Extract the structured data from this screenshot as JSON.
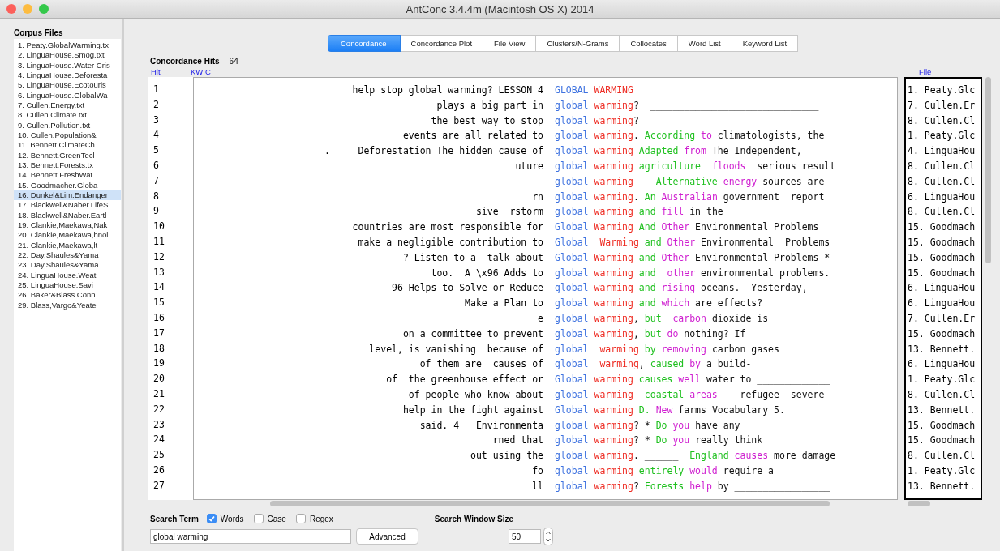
{
  "window": {
    "title": "AntConc 3.4.4m (Macintosh OS X) 2014"
  },
  "corpus_files": {
    "title": "Corpus Files",
    "items": [
      {
        "label": "1. Peaty.GlobalWarming.tx",
        "selected": false
      },
      {
        "label": "2. LinguaHouse.Smog.txt",
        "selected": false
      },
      {
        "label": "3. LinguaHouse.Water Cris",
        "selected": false
      },
      {
        "label": "4. LinguaHouse.Deforesta",
        "selected": false
      },
      {
        "label": "5. LinguaHouse.Ecotouris",
        "selected": false
      },
      {
        "label": "6. LinguaHouse.GlobalWa",
        "selected": false
      },
      {
        "label": "7. Cullen.Energy.txt",
        "selected": false
      },
      {
        "label": "8. Cullen.Climate.txt",
        "selected": false
      },
      {
        "label": "9. Cullen.Pollution.txt",
        "selected": false
      },
      {
        "label": "10. Cullen.Population&",
        "selected": false
      },
      {
        "label": "11. Bennett.ClimateCh",
        "selected": false
      },
      {
        "label": "12. Bennett.GreenTecl",
        "selected": false
      },
      {
        "label": "13. Bennett.Forests.tx",
        "selected": false
      },
      {
        "label": "14. Bennett.FreshWat",
        "selected": false
      },
      {
        "label": "15. Goodmacher.Globa",
        "selected": false
      },
      {
        "label": "16. Dunkel&Lim.Endanger",
        "selected": true
      },
      {
        "label": "17. Blackwell&Naber.LifeS",
        "selected": false
      },
      {
        "label": "18. Blackwell&Naber.Eartl",
        "selected": false
      },
      {
        "label": "19. Clankie,Maekawa,Nak",
        "selected": false
      },
      {
        "label": "20. Clankie,Maekawa,hnol",
        "selected": false
      },
      {
        "label": "21. Clankie,Maekawa,lt",
        "selected": false
      },
      {
        "label": "22. Day,Shaules&Yama",
        "selected": false
      },
      {
        "label": "23. Day,Shaules&Yama",
        "selected": false
      },
      {
        "label": "24. LinguaHouse.Weat",
        "selected": false
      },
      {
        "label": "25. LinguaHouse.Savi",
        "selected": false
      },
      {
        "label": "26. Baker&Blass.Conn",
        "selected": false
      },
      {
        "label": "29. Blass,Vargo&Yeate",
        "selected": false
      }
    ]
  },
  "tabs": [
    {
      "label": "Concordance",
      "selected": true
    },
    {
      "label": "Concordance Plot",
      "selected": false
    },
    {
      "label": "File View",
      "selected": false
    },
    {
      "label": "Clusters/N-Grams",
      "selected": false
    },
    {
      "label": "Collocates",
      "selected": false
    },
    {
      "label": "Word List",
      "selected": false
    },
    {
      "label": "Keyword List",
      "selected": false
    }
  ],
  "hits": {
    "label": "Concordance Hits",
    "count": "64"
  },
  "columns": [
    "Hit",
    "KWIC",
    "File"
  ],
  "rows": [
    {
      "hit": "1",
      "left": "help stop global warming? LESSON 4",
      "right": [
        {
          "t": "GLOBAL",
          "kind": "n1"
        },
        {
          "t": " WARMING",
          "kind": "n2"
        }
      ],
      "file": "1. Peaty.Glc"
    },
    {
      "hit": "2",
      "left": "plays a big part in",
      "right": [
        {
          "t": "global",
          "kind": "n1"
        },
        {
          "t": " warming",
          "kind": "n2"
        },
        {
          "t": "?  ______________________________",
          "kind": "p"
        }
      ],
      "file": "7. Cullen.Er"
    },
    {
      "hit": "3",
      "left": "the best way to stop",
      "right": [
        {
          "t": "global",
          "kind": "n1"
        },
        {
          "t": " warming",
          "kind": "n2"
        },
        {
          "t": "? _______________________________",
          "kind": "p"
        }
      ],
      "file": "8. Cullen.Cl"
    },
    {
      "hit": "4",
      "left": "events are all related to",
      "right": [
        {
          "t": "global",
          "kind": "n1"
        },
        {
          "t": " warming",
          "kind": "n2"
        },
        {
          "t": ".",
          "kind": "p"
        },
        {
          "t": " According",
          "kind": "r1"
        },
        {
          "t": " to",
          "kind": "r2"
        },
        {
          "t": " climatologists, the",
          "kind": "p"
        }
      ],
      "file": "1. Peaty.Glc"
    },
    {
      "hit": "5",
      "left": ".     Deforestation The hidden cause of",
      "right": [
        {
          "t": "global",
          "kind": "n1"
        },
        {
          "t": " warming",
          "kind": "n2"
        },
        {
          "t": " Adapted",
          "kind": "r1"
        },
        {
          "t": " from",
          "kind": "r2"
        },
        {
          "t": " The Independent,",
          "kind": "p"
        }
      ],
      "file": "4. LinguaHou"
    },
    {
      "hit": "6",
      "left": "uture",
      "right": [
        {
          "t": "global",
          "kind": "n1"
        },
        {
          "t": " warming",
          "kind": "n2"
        },
        {
          "t": " agriculture",
          "kind": "r1"
        },
        {
          "t": "  floods",
          "kind": "r2"
        },
        {
          "t": "  serious result",
          "kind": "p"
        }
      ],
      "file": "8. Cullen.Cl"
    },
    {
      "hit": "7",
      "right": [
        {
          "t": "global",
          "kind": "n1"
        },
        {
          "t": " warming",
          "kind": "n2"
        },
        {
          "t": "    Alternative",
          "kind": "r1"
        },
        {
          "t": " energy",
          "kind": "r2"
        },
        {
          "t": " sources are",
          "kind": "p"
        }
      ],
      "file": "8. Cullen.Cl"
    },
    {
      "hit": "8",
      "left": "rn",
      "right": [
        {
          "t": "global",
          "kind": "n1"
        },
        {
          "t": " warming",
          "kind": "n2"
        },
        {
          "t": ".",
          "kind": "p"
        },
        {
          "t": " An",
          "kind": "r1"
        },
        {
          "t": " Australian",
          "kind": "r2"
        },
        {
          "t": " government  report",
          "kind": "p"
        }
      ],
      "file": "6. LinguaHou"
    },
    {
      "hit": "9",
      "left": "sive  rstorm",
      "right": [
        {
          "t": "global",
          "kind": "n1"
        },
        {
          "t": " warming",
          "kind": "n2"
        },
        {
          "t": " and",
          "kind": "r1"
        },
        {
          "t": " fill",
          "kind": "r2"
        },
        {
          "t": " in the",
          "kind": "p"
        }
      ],
      "file": "8. Cullen.Cl"
    },
    {
      "hit": "10",
      "left": "countries are most responsible for",
      "right": [
        {
          "t": "Global",
          "kind": "n1"
        },
        {
          "t": " Warming",
          "kind": "n2"
        },
        {
          "t": " And",
          "kind": "r1"
        },
        {
          "t": " Other",
          "kind": "r2"
        },
        {
          "t": " Environmental Problems",
          "kind": "p"
        }
      ],
      "file": "15. Goodmach"
    },
    {
      "hit": "11",
      "left": "make a negligible contribution to",
      "right": [
        {
          "t": "Global",
          "kind": "n1"
        },
        {
          "t": "  Warming",
          "kind": "n2"
        },
        {
          "t": " and",
          "kind": "r1"
        },
        {
          "t": " Other",
          "kind": "r2"
        },
        {
          "t": " Environmental  Problems",
          "kind": "p"
        }
      ],
      "file": "15. Goodmach"
    },
    {
      "hit": "12",
      "left": "? Listen to a  talk about",
      "right": [
        {
          "t": "Global",
          "kind": "n1"
        },
        {
          "t": " Warming",
          "kind": "n2"
        },
        {
          "t": " and",
          "kind": "r1"
        },
        {
          "t": " Other",
          "kind": "r2"
        },
        {
          "t": " Environmental Problems *",
          "kind": "p"
        }
      ],
      "file": "15. Goodmach"
    },
    {
      "hit": "13",
      "left": "too.  A \\x96 Adds to",
      "right": [
        {
          "t": "global",
          "kind": "n1"
        },
        {
          "t": " warming",
          "kind": "n2"
        },
        {
          "t": " and",
          "kind": "r1"
        },
        {
          "t": "  other",
          "kind": "r2"
        },
        {
          "t": " environmental problems.",
          "kind": "p"
        }
      ],
      "file": "15. Goodmach"
    },
    {
      "hit": "14",
      "left": "96 Helps to Solve or Reduce",
      "right": [
        {
          "t": "global",
          "kind": "n1"
        },
        {
          "t": " warming",
          "kind": "n2"
        },
        {
          "t": " and",
          "kind": "r1"
        },
        {
          "t": " rising",
          "kind": "r2"
        },
        {
          "t": " oceans.  Yesterday,",
          "kind": "p"
        }
      ],
      "file": "6. LinguaHou"
    },
    {
      "hit": "15",
      "left": "Make a Plan to",
      "right": [
        {
          "t": "global",
          "kind": "n1"
        },
        {
          "t": " warming",
          "kind": "n2"
        },
        {
          "t": " and",
          "kind": "r1"
        },
        {
          "t": " which",
          "kind": "r2"
        },
        {
          "t": " are effects?",
          "kind": "p"
        }
      ],
      "file": "6. LinguaHou"
    },
    {
      "hit": "16",
      "left": "e",
      "right": [
        {
          "t": "global",
          "kind": "n1"
        },
        {
          "t": " warming",
          "kind": "n2"
        },
        {
          "t": ",",
          "kind": "p"
        },
        {
          "t": " but",
          "kind": "r1"
        },
        {
          "t": "  carbon",
          "kind": "r2"
        },
        {
          "t": " dioxide is",
          "kind": "p"
        }
      ],
      "file": "7. Cullen.Er"
    },
    {
      "hit": "17",
      "left": "on a committee to prevent",
      "right": [
        {
          "t": "global",
          "kind": "n1"
        },
        {
          "t": " warming",
          "kind": "n2"
        },
        {
          "t": ",",
          "kind": "p"
        },
        {
          "t": " but",
          "kind": "r1"
        },
        {
          "t": " do",
          "kind": "r2"
        },
        {
          "t": " nothing? If",
          "kind": "p"
        }
      ],
      "file": "15. Goodmach"
    },
    {
      "hit": "18",
      "left": "level, is vanishing  because of",
      "right": [
        {
          "t": "global",
          "kind": "n1"
        },
        {
          "t": "  warming",
          "kind": "n2"
        },
        {
          "t": " by",
          "kind": "r1"
        },
        {
          "t": " removing",
          "kind": "r2"
        },
        {
          "t": " carbon gases",
          "kind": "p"
        }
      ],
      "file": "13. Bennett."
    },
    {
      "hit": "19",
      "left": "of them are  causes of",
      "right": [
        {
          "t": "global",
          "kind": "n1"
        },
        {
          "t": "  warming",
          "kind": "n2"
        },
        {
          "t": ",",
          "kind": "p"
        },
        {
          "t": " caused",
          "kind": "r1"
        },
        {
          "t": " by",
          "kind": "r2"
        },
        {
          "t": " a build-",
          "kind": "p"
        }
      ],
      "file": "6. LinguaHou"
    },
    {
      "hit": "20",
      "left": "of  the greenhouse effect or",
      "right": [
        {
          "t": "Global",
          "kind": "n1"
        },
        {
          "t": " warming",
          "kind": "n2"
        },
        {
          "t": " causes",
          "kind": "r1"
        },
        {
          "t": " well",
          "kind": "r2"
        },
        {
          "t": " water to _____________",
          "kind": "p"
        }
      ],
      "file": "1. Peaty.Glc"
    },
    {
      "hit": "21",
      "left": "of people who know about",
      "right": [
        {
          "t": "global",
          "kind": "n1"
        },
        {
          "t": " warming",
          "kind": "n2"
        },
        {
          "t": "  coastal",
          "kind": "r1"
        },
        {
          "t": " areas",
          "kind": "r2"
        },
        {
          "t": "    refugee  severe",
          "kind": "p"
        }
      ],
      "file": "8. Cullen.Cl"
    },
    {
      "hit": "22",
      "left": "help in the fight against",
      "right": [
        {
          "t": "Global",
          "kind": "n1"
        },
        {
          "t": " warming",
          "kind": "n2"
        },
        {
          "t": " D.",
          "kind": "r1"
        },
        {
          "t": " New",
          "kind": "r2"
        },
        {
          "t": " farms Vocabulary 5.",
          "kind": "p"
        }
      ],
      "file": "13. Bennett."
    },
    {
      "hit": "23",
      "left": "said. 4   Environmenta",
      "right": [
        {
          "t": "global",
          "kind": "n1"
        },
        {
          "t": " warming",
          "kind": "n2"
        },
        {
          "t": "? *",
          "kind": "p"
        },
        {
          "t": " Do",
          "kind": "r1"
        },
        {
          "t": " you",
          "kind": "r2"
        },
        {
          "t": " have any",
          "kind": "p"
        }
      ],
      "file": "15. Goodmach"
    },
    {
      "hit": "24",
      "left": "rned that",
      "right": [
        {
          "t": "global",
          "kind": "n1"
        },
        {
          "t": " warming",
          "kind": "n2"
        },
        {
          "t": "? *",
          "kind": "p"
        },
        {
          "t": " Do",
          "kind": "r1"
        },
        {
          "t": " you",
          "kind": "r2"
        },
        {
          "t": " really think",
          "kind": "p"
        }
      ],
      "file": "15. Goodmach"
    },
    {
      "hit": "25",
      "left": "out using the",
      "right": [
        {
          "t": "global",
          "kind": "n1"
        },
        {
          "t": " warming",
          "kind": "n2"
        },
        {
          "t": ". ______",
          "kind": "p"
        },
        {
          "t": "  England",
          "kind": "r1"
        },
        {
          "t": " causes",
          "kind": "r2"
        },
        {
          "t": " more damage",
          "kind": "p"
        }
      ],
      "file": "8. Cullen.Cl"
    },
    {
      "hit": "26",
      "left": "fo",
      "right": [
        {
          "t": "global",
          "kind": "n1"
        },
        {
          "t": " warming",
          "kind": "n2"
        },
        {
          "t": " entirely",
          "kind": "r1"
        },
        {
          "t": " would",
          "kind": "r2"
        },
        {
          "t": " require a",
          "kind": "p"
        }
      ],
      "file": "1. Peaty.Glc"
    },
    {
      "hit": "27",
      "left": "ll",
      "right": [
        {
          "t": "global",
          "kind": "n1"
        },
        {
          "t": " warming",
          "kind": "n2"
        },
        {
          "t": "?",
          "kind": "p"
        },
        {
          "t": " Forests",
          "kind": "r1"
        },
        {
          "t": " help",
          "kind": "r2"
        },
        {
          "t": " by _________________",
          "kind": "p"
        }
      ],
      "file": "13. Bennett."
    }
  ],
  "search": {
    "label": "Search Term",
    "options": [
      {
        "label": "Words",
        "checked": true
      },
      {
        "label": "Case",
        "checked": false
      },
      {
        "label": "Regex",
        "checked": false
      }
    ],
    "value": "global warming",
    "button": "Advanced"
  },
  "window_size": {
    "label": "Search Window Size",
    "value": "50"
  }
}
